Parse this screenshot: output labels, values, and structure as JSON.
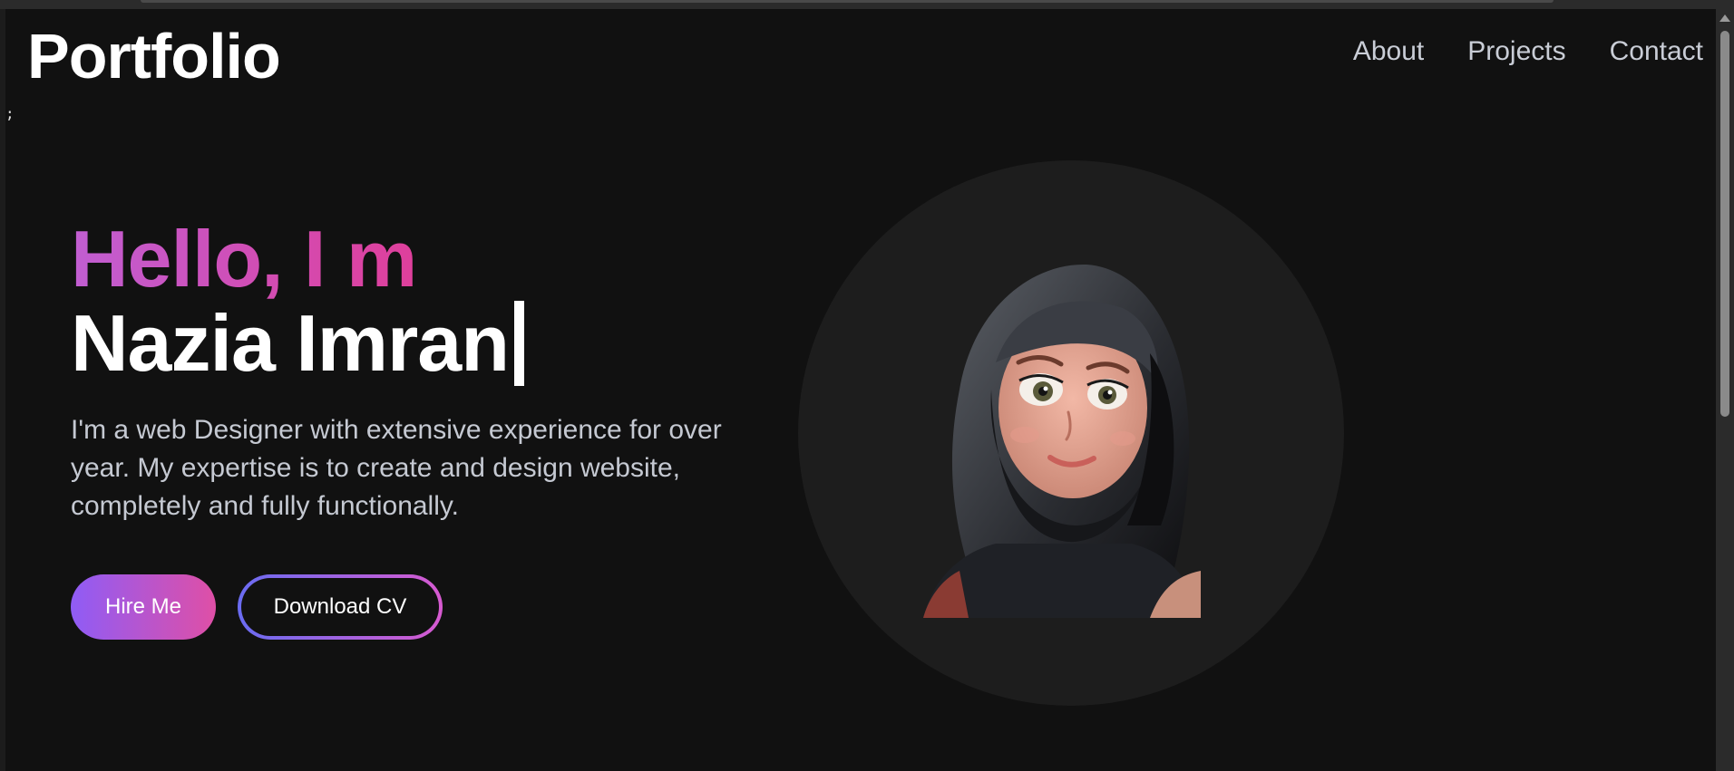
{
  "header": {
    "logo": "Portfolio",
    "stray_text": ";",
    "nav": [
      "About",
      "Projects",
      "Contact"
    ]
  },
  "hero": {
    "greeting": "Hello, I m",
    "name": "Nazia Imran",
    "intro": "I'm a web Designer with extensive experience for over year. My expertise is to create and design website, completely and fully functionally.",
    "hire_label": "Hire Me",
    "cv_label": "Download CV"
  },
  "colors": {
    "background": "#111111",
    "accent_start": "#c15ed2",
    "accent_end": "#df3f9b",
    "button_start": "#8f5cf6",
    "button_end": "#df4fa6"
  },
  "icons": {
    "avatar": "hijab-girl-avatar"
  }
}
